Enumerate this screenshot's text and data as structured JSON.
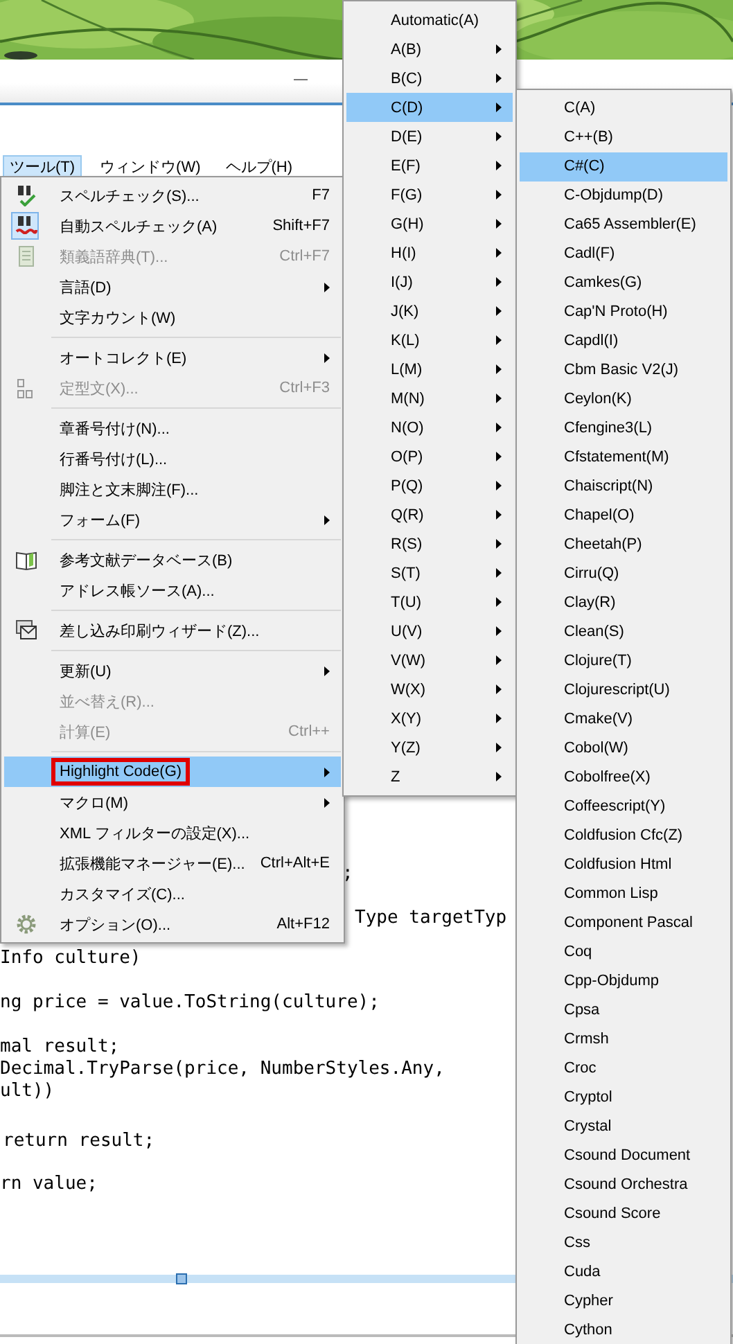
{
  "menubar": [
    {
      "label": "ツール(T)",
      "selected": true
    },
    {
      "label": "ウィンドウ(W)",
      "selected": false
    },
    {
      "label": "ヘルプ(H)",
      "selected": false
    }
  ],
  "tools_menu": {
    "items": [
      {
        "kind": "item",
        "label": "スペルチェック(S)...",
        "shortcut": "F7",
        "submenu": false,
        "disabled": false,
        "checked": false,
        "selected": false,
        "outlined": false
      },
      {
        "kind": "item",
        "label": "自動スペルチェック(A)",
        "shortcut": "Shift+F7",
        "submenu": false,
        "disabled": false,
        "checked": true,
        "selected": false,
        "outlined": false
      },
      {
        "kind": "item",
        "label": "類義語辞典(T)...",
        "shortcut": "Ctrl+F7",
        "submenu": false,
        "disabled": true,
        "checked": false,
        "selected": false,
        "outlined": false
      },
      {
        "kind": "item",
        "label": "言語(D)",
        "submenu": true,
        "disabled": false,
        "checked": false,
        "selected": false,
        "outlined": false
      },
      {
        "kind": "item",
        "label": "文字カウント(W)",
        "submenu": false,
        "disabled": false,
        "checked": false,
        "selected": false,
        "outlined": false
      },
      {
        "kind": "separator"
      },
      {
        "kind": "item",
        "label": "オートコレクト(E)",
        "submenu": true,
        "disabled": false,
        "checked": false,
        "selected": false,
        "outlined": false
      },
      {
        "kind": "item",
        "label": "定型文(X)...",
        "shortcut": "Ctrl+F3",
        "submenu": false,
        "disabled": true,
        "checked": false,
        "selected": false,
        "outlined": false
      },
      {
        "kind": "separator"
      },
      {
        "kind": "item",
        "label": "章番号付け(N)...",
        "submenu": false,
        "disabled": false,
        "checked": false,
        "selected": false,
        "outlined": false
      },
      {
        "kind": "item",
        "label": "行番号付け(L)...",
        "submenu": false,
        "disabled": false,
        "checked": false,
        "selected": false,
        "outlined": false
      },
      {
        "kind": "item",
        "label": "脚注と文末脚注(F)...",
        "submenu": false,
        "disabled": false,
        "checked": false,
        "selected": false,
        "outlined": false
      },
      {
        "kind": "item",
        "label": "フォーム(F)",
        "submenu": true,
        "disabled": false,
        "checked": false,
        "selected": false,
        "outlined": false
      },
      {
        "kind": "separator"
      },
      {
        "kind": "item",
        "label": "参考文献データベース(B)",
        "submenu": false,
        "disabled": false,
        "checked": false,
        "selected": false,
        "outlined": false
      },
      {
        "kind": "item",
        "label": "アドレス帳ソース(A)...",
        "submenu": false,
        "disabled": false,
        "checked": false,
        "selected": false,
        "outlined": false
      },
      {
        "kind": "separator"
      },
      {
        "kind": "item",
        "label": "差し込み印刷ウィザード(Z)...",
        "submenu": false,
        "disabled": false,
        "checked": false,
        "selected": false,
        "outlined": false
      },
      {
        "kind": "separator"
      },
      {
        "kind": "item",
        "label": "更新(U)",
        "submenu": true,
        "disabled": false,
        "checked": false,
        "selected": false,
        "outlined": false
      },
      {
        "kind": "item",
        "label": "並べ替え(R)...",
        "submenu": false,
        "disabled": true,
        "checked": false,
        "selected": false,
        "outlined": false
      },
      {
        "kind": "item",
        "label": "計算(E)",
        "shortcut": "Ctrl++",
        "submenu": false,
        "disabled": true,
        "checked": false,
        "selected": false,
        "outlined": false
      },
      {
        "kind": "separator"
      },
      {
        "kind": "item",
        "label": "Highlight Code(G)",
        "submenu": true,
        "disabled": false,
        "checked": false,
        "selected": true,
        "outlined": true
      },
      {
        "kind": "item",
        "label": "マクロ(M)",
        "submenu": true,
        "disabled": false,
        "checked": false,
        "selected": false,
        "outlined": false
      },
      {
        "kind": "item",
        "label": "XML フィルターの設定(X)...",
        "submenu": false,
        "disabled": false,
        "checked": false,
        "selected": false,
        "outlined": false
      },
      {
        "kind": "item",
        "label": "拡張機能マネージャー(E)...",
        "shortcut": "Ctrl+Alt+E",
        "submenu": false,
        "disabled": false,
        "checked": false,
        "selected": false,
        "outlined": false
      },
      {
        "kind": "item",
        "label": "カスタマイズ(C)...",
        "submenu": false,
        "disabled": false,
        "checked": false,
        "selected": false,
        "outlined": false
      },
      {
        "kind": "item",
        "label": "オプション(O)...",
        "shortcut": "Alt+F12",
        "submenu": false,
        "disabled": false,
        "checked": false,
        "selected": false,
        "outlined": false
      }
    ]
  },
  "highlight_submenu": {
    "items": [
      {
        "label": "Automatic(A)",
        "submenu": false,
        "selected": false
      },
      {
        "label": "A(B)",
        "submenu": true,
        "selected": false
      },
      {
        "label": "B(C)",
        "submenu": true,
        "selected": false
      },
      {
        "label": "C(D)",
        "submenu": true,
        "selected": true
      },
      {
        "label": "D(E)",
        "submenu": true,
        "selected": false
      },
      {
        "label": "E(F)",
        "submenu": true,
        "selected": false
      },
      {
        "label": "F(G)",
        "submenu": true,
        "selected": false
      },
      {
        "label": "G(H)",
        "submenu": true,
        "selected": false
      },
      {
        "label": "H(I)",
        "submenu": true,
        "selected": false
      },
      {
        "label": "I(J)",
        "submenu": true,
        "selected": false
      },
      {
        "label": "J(K)",
        "submenu": true,
        "selected": false
      },
      {
        "label": "K(L)",
        "submenu": true,
        "selected": false
      },
      {
        "label": "L(M)",
        "submenu": true,
        "selected": false
      },
      {
        "label": "M(N)",
        "submenu": true,
        "selected": false
      },
      {
        "label": "N(O)",
        "submenu": true,
        "selected": false
      },
      {
        "label": "O(P)",
        "submenu": true,
        "selected": false
      },
      {
        "label": "P(Q)",
        "submenu": true,
        "selected": false
      },
      {
        "label": "Q(R)",
        "submenu": true,
        "selected": false
      },
      {
        "label": "R(S)",
        "submenu": true,
        "selected": false
      },
      {
        "label": "S(T)",
        "submenu": true,
        "selected": false
      },
      {
        "label": "T(U)",
        "submenu": true,
        "selected": false
      },
      {
        "label": "U(V)",
        "submenu": true,
        "selected": false
      },
      {
        "label": "V(W)",
        "submenu": true,
        "selected": false
      },
      {
        "label": "W(X)",
        "submenu": true,
        "selected": false
      },
      {
        "label": "X(Y)",
        "submenu": true,
        "selected": false
      },
      {
        "label": "Y(Z)",
        "submenu": true,
        "selected": false
      },
      {
        "label": "Z",
        "submenu": true,
        "selected": false
      }
    ]
  },
  "language_submenu": {
    "items": [
      {
        "label": "C(A)",
        "selected": false
      },
      {
        "label": "C++(B)",
        "selected": false
      },
      {
        "label": "C#(C)",
        "selected": true
      },
      {
        "label": "C-Objdump(D)",
        "selected": false
      },
      {
        "label": "Ca65 Assembler(E)",
        "selected": false
      },
      {
        "label": "Cadl(F)",
        "selected": false
      },
      {
        "label": "Camkes(G)",
        "selected": false
      },
      {
        "label": "Cap'N Proto(H)",
        "selected": false
      },
      {
        "label": "Capdl(I)",
        "selected": false
      },
      {
        "label": "Cbm Basic V2(J)",
        "selected": false
      },
      {
        "label": "Ceylon(K)",
        "selected": false
      },
      {
        "label": "Cfengine3(L)",
        "selected": false
      },
      {
        "label": "Cfstatement(M)",
        "selected": false
      },
      {
        "label": "Chaiscript(N)",
        "selected": false
      },
      {
        "label": "Chapel(O)",
        "selected": false
      },
      {
        "label": "Cheetah(P)",
        "selected": false
      },
      {
        "label": "Cirru(Q)",
        "selected": false
      },
      {
        "label": "Clay(R)",
        "selected": false
      },
      {
        "label": "Clean(S)",
        "selected": false
      },
      {
        "label": "Clojure(T)",
        "selected": false
      },
      {
        "label": "Clojurescript(U)",
        "selected": false
      },
      {
        "label": "Cmake(V)",
        "selected": false
      },
      {
        "label": "Cobol(W)",
        "selected": false
      },
      {
        "label": "Cobolfree(X)",
        "selected": false
      },
      {
        "label": "Coffeescript(Y)",
        "selected": false
      },
      {
        "label": "Coldfusion Cfc(Z)",
        "selected": false
      },
      {
        "label": "Coldfusion Html",
        "selected": false
      },
      {
        "label": "Common Lisp",
        "selected": false
      },
      {
        "label": "Component Pascal",
        "selected": false
      },
      {
        "label": "Coq",
        "selected": false
      },
      {
        "label": "Cpp-Objdump",
        "selected": false
      },
      {
        "label": "Cpsa",
        "selected": false
      },
      {
        "label": "Crmsh",
        "selected": false
      },
      {
        "label": "Croc",
        "selected": false
      },
      {
        "label": "Cryptol",
        "selected": false
      },
      {
        "label": "Crystal",
        "selected": false
      },
      {
        "label": "Csound Document",
        "selected": false
      },
      {
        "label": "Csound Orchestra",
        "selected": false
      },
      {
        "label": "Csound Score",
        "selected": false
      },
      {
        "label": "Css",
        "selected": false
      },
      {
        "label": "Cuda",
        "selected": false
      },
      {
        "label": "Cypher",
        "selected": false
      },
      {
        "label": "Cython",
        "selected": false
      }
    ]
  },
  "editor": {
    "code_lines": [
      ";",
      "Type targetTyp",
      "Info culture)",
      "ng price = value.ToString(culture);",
      "mal result;",
      "Decimal.TryParse(price, NumberStyles.Any,",
      "ult))",
      "return result;",
      "rn value;"
    ]
  }
}
